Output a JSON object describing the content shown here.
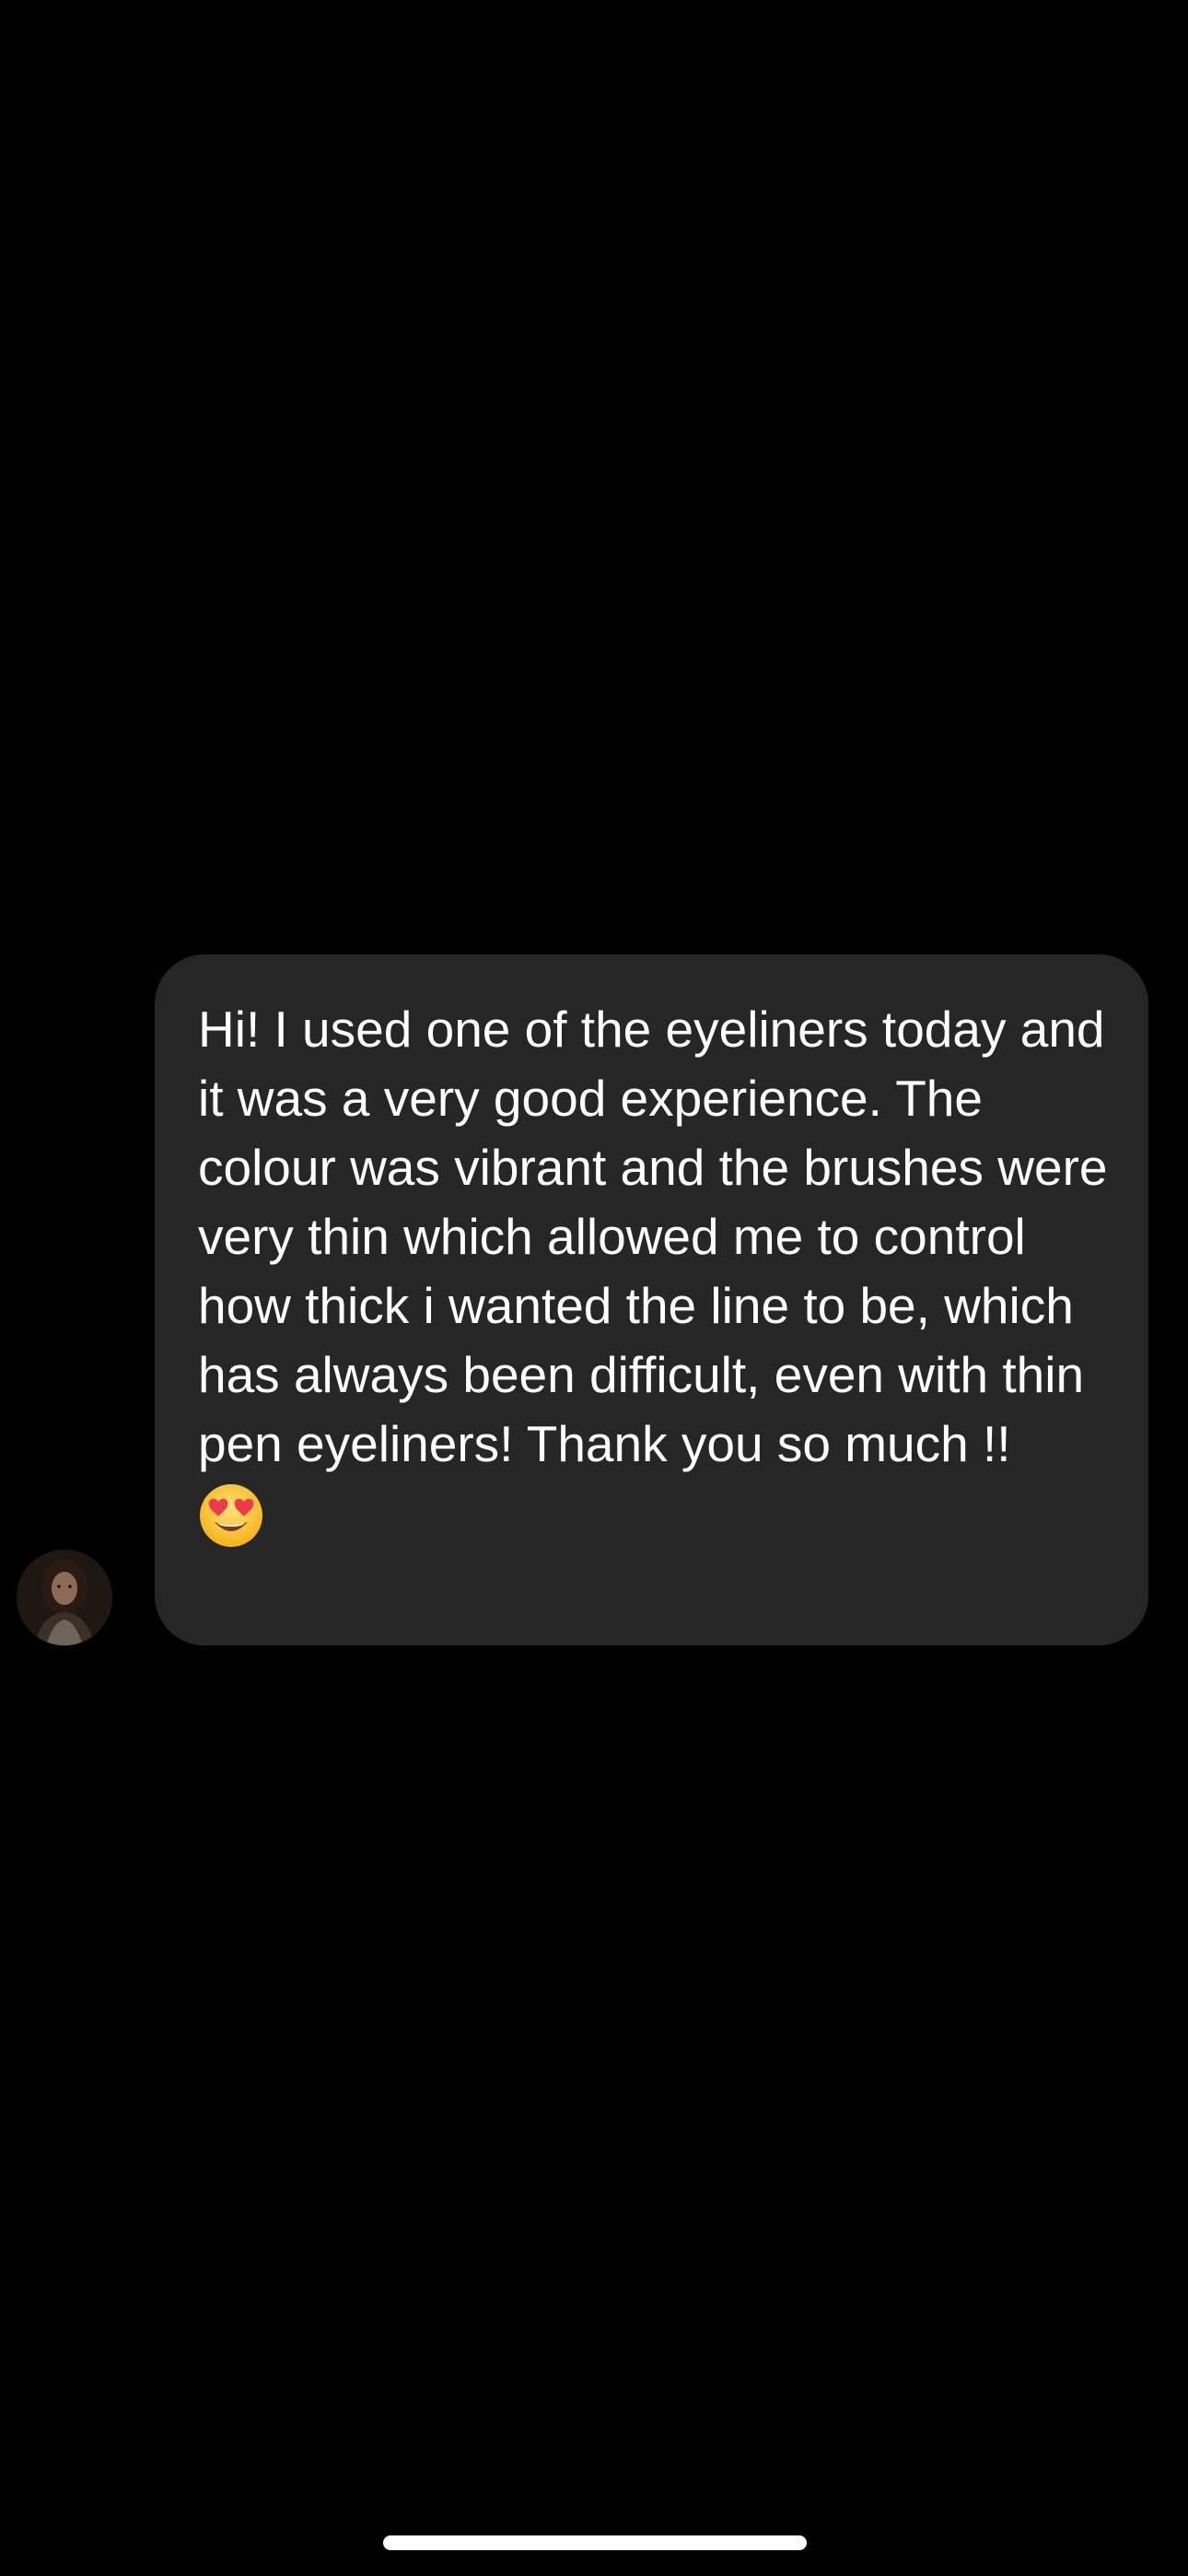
{
  "conversation": {
    "message": {
      "text": "Hi! I used one of the eyeliners today and it was a very good experience. The colour was vibrant and the brushes were very thin which allowed me to control how thick i wanted the line to be, which has always been difficult, even with thin pen eyeliners! Thank you so much !!",
      "emoji": "heart-eyes-emoji",
      "bubble_color": "#262626",
      "text_color": "#ffffff"
    },
    "sender": {
      "avatar_icon": "profile-photo"
    }
  },
  "background_color": "#000000",
  "home_indicator_color": "#ffffff"
}
